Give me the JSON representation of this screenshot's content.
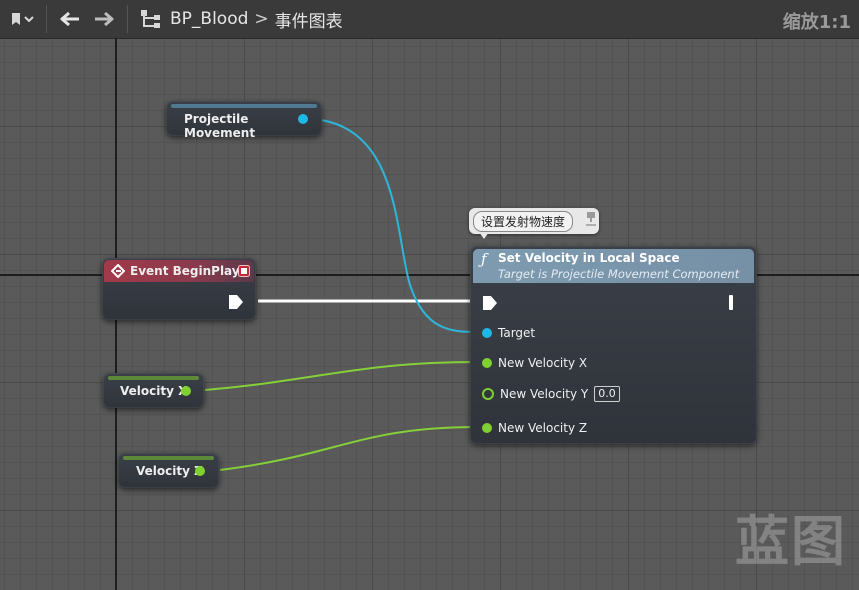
{
  "toolbar": {
    "breadcrumb_asset": "BP_Blood",
    "breadcrumb_sep": ">",
    "breadcrumb_graph": "事件图表",
    "zoom_label": "缩放1:1"
  },
  "nodes": {
    "projectile_movement": {
      "label": "Projectile Movement",
      "pin_color": "#1fb7e5"
    },
    "event_begin_play": {
      "title": "Event BeginPlay",
      "header_color": "#a23a4a"
    },
    "velocity_x": {
      "label": "Velocity X",
      "pin_color": "#7fd12f"
    },
    "velocity_z": {
      "label": "Velocity Z",
      "pin_color": "#7fd12f"
    },
    "set_velocity": {
      "title": "Set Velocity in Local Space",
      "subtitle": "Target is Projectile Movement Component",
      "comment": "设置发射物速度",
      "pins": {
        "target": "Target",
        "new_velocity_x": "New Velocity X",
        "new_velocity_y": "New Velocity Y",
        "new_velocity_y_value": "0.0",
        "new_velocity_z": "New Velocity Z"
      }
    }
  },
  "watermark": "蓝图",
  "colors": {
    "object_pin": "#1fb7e5",
    "float_pin": "#7fd12f",
    "exec_wire": "#ffffff",
    "canvas": "#5a5a5a"
  }
}
